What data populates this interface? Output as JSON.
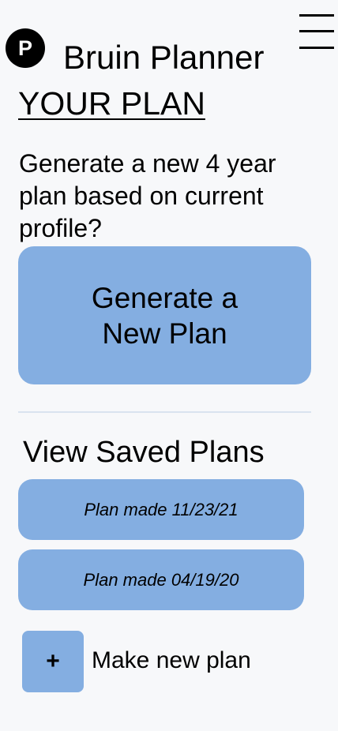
{
  "header": {
    "logo_letter": "P",
    "app_title": "Bruin Planner",
    "menu_icon": "hamburger-menu-icon"
  },
  "plan_section": {
    "title": "YOUR PLAN",
    "prompt": "Generate a new 4 year plan based on current profile?",
    "generate_button_label": "Generate a New Plan"
  },
  "saved_plans": {
    "title": "View Saved Plans",
    "items": [
      {
        "label": "Plan made 11/23/21"
      },
      {
        "label": "Plan made 04/19/20"
      }
    ]
  },
  "new_plan": {
    "icon_glyph": "+",
    "label": "Make new plan"
  },
  "colors": {
    "background": "#f7f8fa",
    "button": "#84aee1",
    "divider": "#d9e3ef",
    "text": "#000000"
  }
}
